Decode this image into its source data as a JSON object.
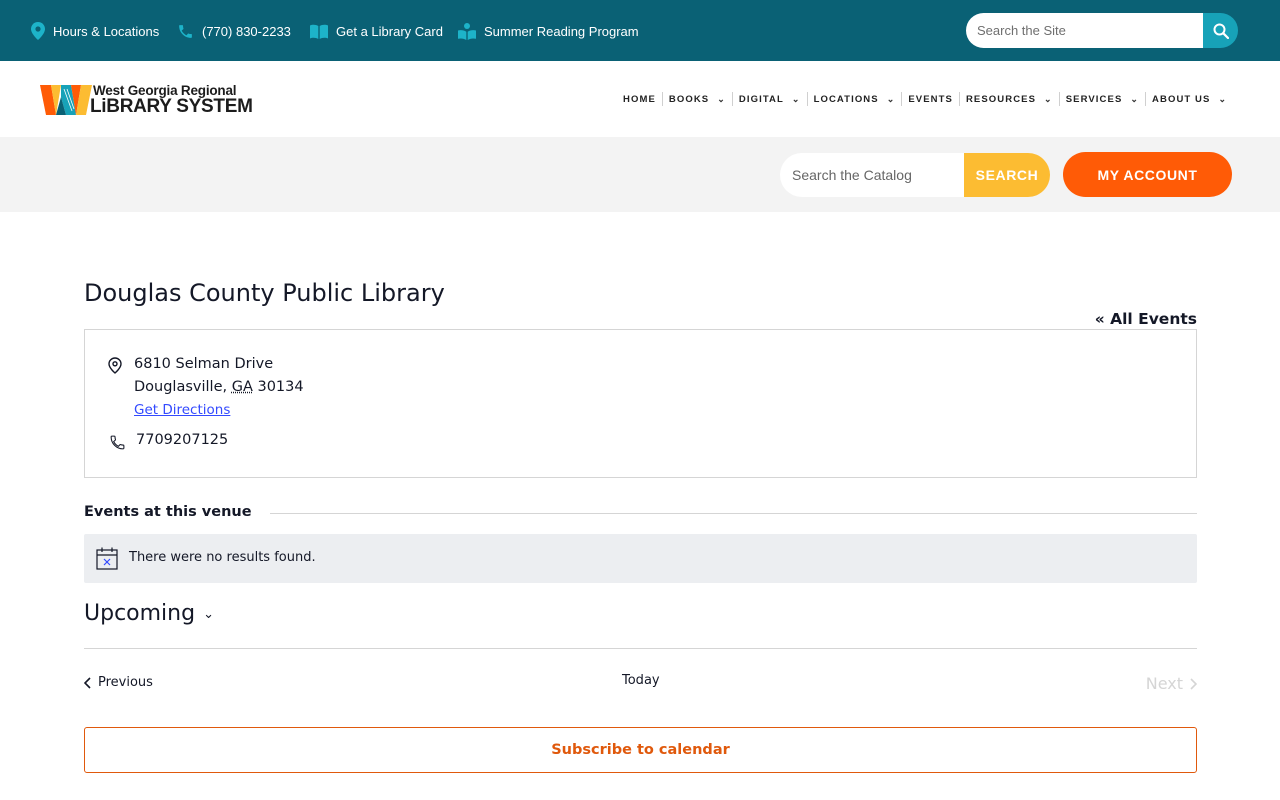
{
  "topbar": {
    "links": [
      {
        "label": "Hours & Locations",
        "icon": "map-pin-icon"
      },
      {
        "label": "(770) 830-2233",
        "icon": "phone-icon"
      },
      {
        "label": "Get a Library Card",
        "icon": "book-icon"
      },
      {
        "label": "Summer Reading Program",
        "icon": "reading-icon"
      }
    ],
    "search_placeholder": "Search the Site",
    "search_icon": "search-icon"
  },
  "header": {
    "logo_line1": "West Georgia Regional",
    "logo_line2": "LiBRARY SYSTEM",
    "nav": [
      {
        "label": "HOME",
        "dropdown": false
      },
      {
        "label": "BOOKS",
        "dropdown": true
      },
      {
        "label": "DIGITAL",
        "dropdown": true
      },
      {
        "label": "LOCATIONS",
        "dropdown": true
      },
      {
        "label": "EVENTS",
        "dropdown": false
      },
      {
        "label": "RESOURCES",
        "dropdown": true
      },
      {
        "label": "SERVICES",
        "dropdown": true
      },
      {
        "label": "ABOUT US",
        "dropdown": true
      }
    ]
  },
  "catalog": {
    "placeholder": "Search the Catalog",
    "search_label": "SEARCH",
    "account_label": "MY ACCOUNT"
  },
  "venue": {
    "title": "Douglas County Public Library",
    "all_events": "« All Events",
    "street": "6810 Selman Drive",
    "city": "Douglasville",
    "state": "GA",
    "zip": "30134",
    "directions": "Get Directions",
    "phone": "7709207125"
  },
  "events": {
    "heading": "Events at this venue",
    "notice": "There were no results found.",
    "view": "Upcoming",
    "prev": "Previous",
    "today": "Today",
    "next": "Next",
    "subscribe": "Subscribe to calendar"
  },
  "colors": {
    "topbar": "#0a6175",
    "search_button": "#17a2b8",
    "catalog_button": "#fcbc32",
    "account_button": "#ff5b06",
    "accent_orange": "#e0590c",
    "link_blue": "#334aff"
  }
}
